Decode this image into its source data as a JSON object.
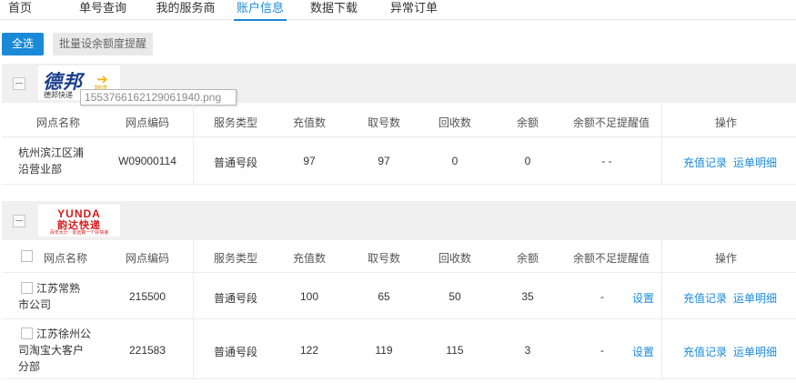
{
  "nav": {
    "items": [
      {
        "label": "首页"
      },
      {
        "label": "单号查询"
      },
      {
        "label": "我的服务商"
      },
      {
        "label": "账户信息"
      },
      {
        "label": "数据下载"
      },
      {
        "label": "异常订单"
      }
    ],
    "active": "账户信息"
  },
  "toolbar": {
    "select_all_label": "全选",
    "batch_label": "批量设余额度提醒"
  },
  "colors": {
    "accent": "#1a8ad8",
    "header_bg": "#f0f0f0"
  },
  "carriers": [
    {
      "logo": {
        "text_main": "德邦",
        "text_sub": "物流",
        "text_bottom": "德邦快递",
        "icon": "arrow-icon"
      },
      "tooltip": "1553766162129061940.png",
      "headers": [
        "网点名称",
        "网点编码",
        "服务类型",
        "充值数",
        "取号数",
        "回收数",
        "余额",
        "余额不足提醒值",
        "操作"
      ],
      "rows": [
        {
          "name": "杭州滨江区浦沿营业部",
          "code": "W09000114",
          "service": "普通号段",
          "recharge": "97",
          "taken": "97",
          "recycled": "0",
          "balance": "0",
          "threshold": "- -",
          "action1": "充值记录",
          "action2": "运单明细"
        }
      ]
    },
    {
      "logo": {
        "text_en": "YUNDA",
        "text_cn": "韵达快递",
        "slogan": "百年大计 · 永远做一个好快递"
      },
      "headers": [
        "网点名称",
        "网点编码",
        "服务类型",
        "充值数",
        "取号数",
        "回收数",
        "余额",
        "余额不足提醒值",
        "操作"
      ],
      "rows": [
        {
          "name": "江苏常熟市公司",
          "code": "215500",
          "service": "普通号段",
          "recharge": "100",
          "taken": "65",
          "recycled": "50",
          "balance": "35",
          "threshold": "-",
          "set_label": "设置",
          "action1": "充值记录",
          "action2": "运单明细"
        },
        {
          "name": "江苏徐州公司淘宝大客户分部",
          "code": "221583",
          "service": "普通号段",
          "recharge": "122",
          "taken": "119",
          "recycled": "115",
          "balance": "3",
          "threshold": "-",
          "set_label": "设置",
          "action1": "充值记录",
          "action2": "运单明细"
        }
      ]
    }
  ]
}
